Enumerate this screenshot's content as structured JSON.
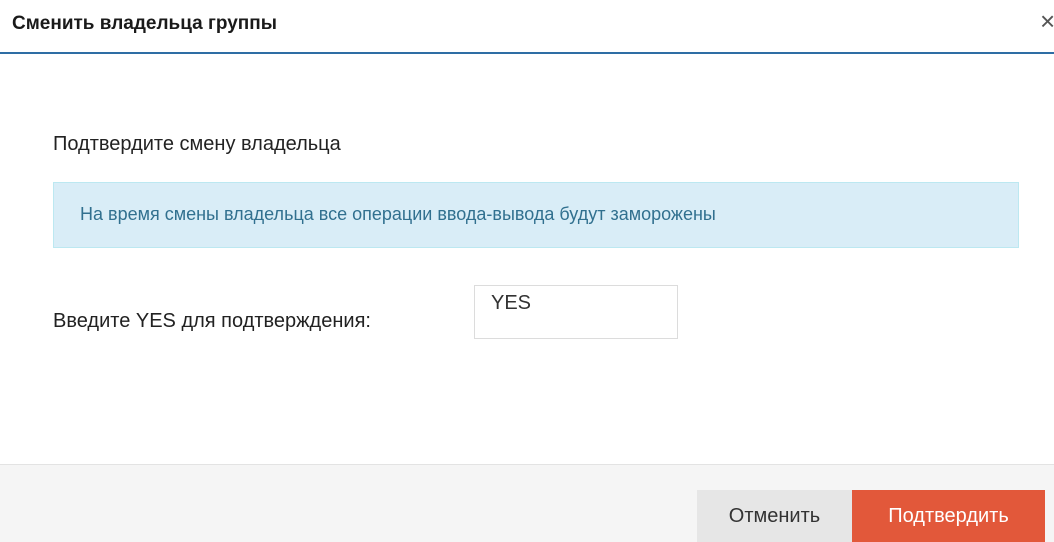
{
  "dialog": {
    "title": "Сменить владельца группы",
    "close_symbol": "×"
  },
  "body": {
    "subtitle": "Подтвердите смену владельца",
    "info_message": "На время смены владельца все операции ввода-вывода будут заморожены",
    "confirm_label": "Введите YES для подтверждения:",
    "confirm_input_value": "YES"
  },
  "footer": {
    "cancel_label": "Отменить",
    "confirm_label": "Подтвердить"
  },
  "colors": {
    "header_border": "#2e6da4",
    "info_background": "#d9edf7",
    "info_text": "#31708f",
    "confirm_button": "#e2583a",
    "cancel_button": "#e6e6e6"
  }
}
